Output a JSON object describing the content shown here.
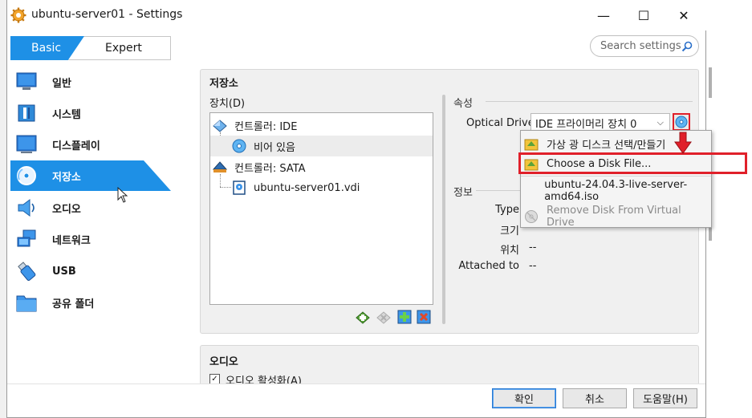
{
  "window": {
    "title": "ubuntu-server01 - Settings",
    "controls": {
      "minimize": "—",
      "maximize": "☐",
      "close": "✕"
    }
  },
  "mode": {
    "basic": "Basic",
    "expert": "Expert",
    "active": "basic"
  },
  "search": {
    "placeholder": "Search settings"
  },
  "sidebar": {
    "items": [
      {
        "label": "일반",
        "icon": "general-icon"
      },
      {
        "label": "시스템",
        "icon": "system-icon"
      },
      {
        "label": "디스플레이",
        "icon": "display-icon"
      },
      {
        "label": "저장소",
        "icon": "storage-icon",
        "selected": true
      },
      {
        "label": "오디오",
        "icon": "audio-icon"
      },
      {
        "label": "네트워크",
        "icon": "network-icon"
      },
      {
        "label": "USB",
        "icon": "usb-icon"
      },
      {
        "label": "공유 폴더",
        "icon": "shared-folder-icon"
      }
    ]
  },
  "storage": {
    "title": "저장소",
    "devices_label": "장치(D)",
    "tree": [
      {
        "label": "컨트롤러: IDE",
        "icon": "ide-controller-icon"
      },
      {
        "label": "비어 있음",
        "icon": "optical-disc-icon",
        "selected": true
      },
      {
        "label": "컨트롤러: SATA",
        "icon": "sata-controller-icon"
      },
      {
        "label": "ubuntu-server01.vdi",
        "icon": "hard-disk-icon"
      }
    ],
    "attributes_label": "속성",
    "optical_drive_label": "Optical Drive",
    "optical_drive_value": "IDE 프라이머리 장치 0",
    "info_label": "정보",
    "info": [
      {
        "key": "Type",
        "value": ""
      },
      {
        "key": "크기",
        "value": ""
      },
      {
        "key": "위치",
        "value": "--"
      },
      {
        "key": "Attached to",
        "value": "--"
      }
    ]
  },
  "menu": {
    "items": [
      {
        "label": "가상 광 디스크 선택/만들기",
        "icon": "optical-disk-select-icon"
      },
      {
        "label": "Choose a Disk File...",
        "icon": "disk-file-icon",
        "highlighted": true
      },
      {
        "label": "ubuntu-24.04.3-live-server-amd64.iso",
        "icon": ""
      },
      {
        "label": "Remove Disk From Virtual Drive",
        "icon": "remove-disk-icon",
        "disabled": true
      }
    ]
  },
  "audio": {
    "title": "오디오",
    "enable_label": "오디오 활성화(A)",
    "checked": true
  },
  "footer": {
    "ok": "확인",
    "cancel": "취소",
    "help": "도움말(H)"
  },
  "colors": {
    "accent": "#1e90e6",
    "highlight_red": "#e0202a"
  }
}
